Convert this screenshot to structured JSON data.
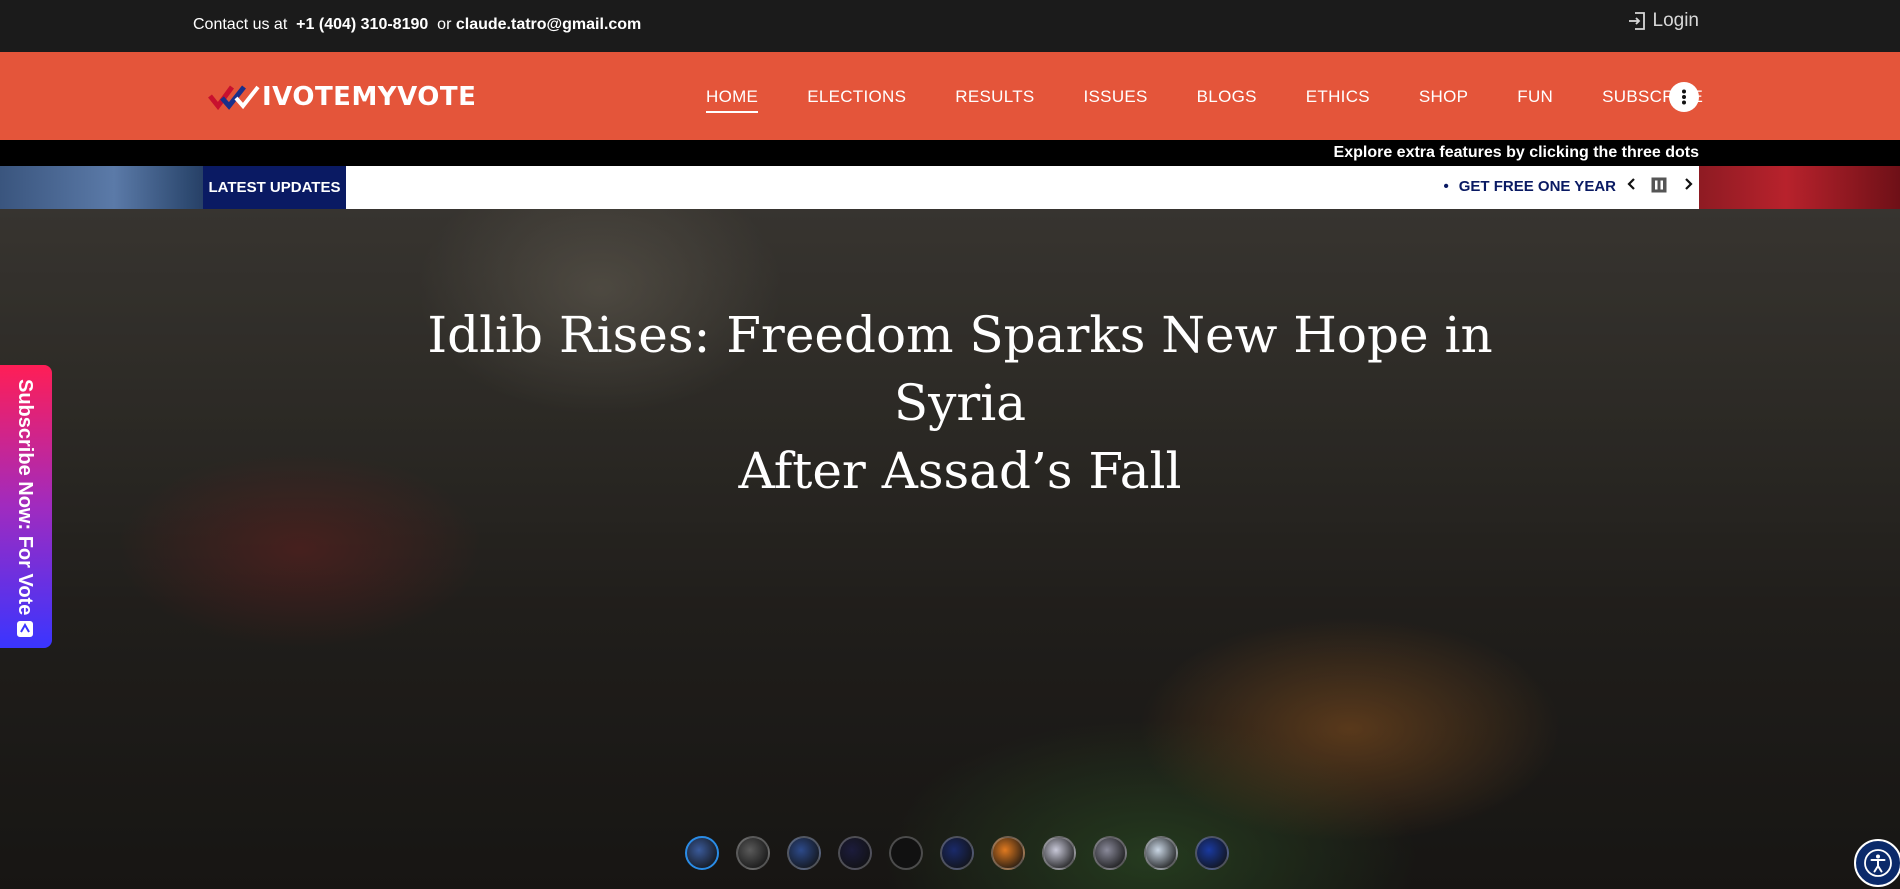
{
  "topbar": {
    "contact_prefix": "Contact us at",
    "phone": "+1 (404) 310-8190",
    "or_text": "or",
    "email": "claude.tatro@gmail.com",
    "login_label": "Login"
  },
  "logo": {
    "part1": "IVOTE",
    "part2": "MYVOTE"
  },
  "nav": {
    "items": [
      {
        "label": "HOME"
      },
      {
        "label": "ELECTIONS"
      },
      {
        "label": "RESULTS"
      },
      {
        "label": "ISSUES"
      },
      {
        "label": "BLOGS"
      },
      {
        "label": "ETHICS"
      },
      {
        "label": "SHOP"
      },
      {
        "label": "FUN"
      },
      {
        "label": "SUBSCRIBE"
      }
    ],
    "active": "HOME"
  },
  "strip": {
    "explore_text": "Explore extra features by clicking the three dots"
  },
  "ticker": {
    "label": "LATEST UPDATES",
    "item": "GET FREE ONE YEAR"
  },
  "hero": {
    "title_line1": "Idlib Rises: Freedom Sparks New Hope in Syria",
    "title_line2": "After Assad’s Fall"
  },
  "subscribe_tab": {
    "label": "Subscribe Now: For Vote"
  },
  "thumbnails": {
    "count": 11,
    "active_index": 0,
    "colors": [
      "#3a5a9a",
      "#5a5a5a",
      "#2d4a8a",
      "#1c1c3c",
      "#111111",
      "#1a2a6a",
      "#e07a20",
      "#c8c8d8",
      "#8a8a9a",
      "#c9d6e4",
      "#1a3aa0"
    ]
  },
  "colors": {
    "nav_bg": "#e4553a",
    "topbar_bg": "#1b1b1b",
    "ticker_label_bg": "#0a1a63"
  }
}
